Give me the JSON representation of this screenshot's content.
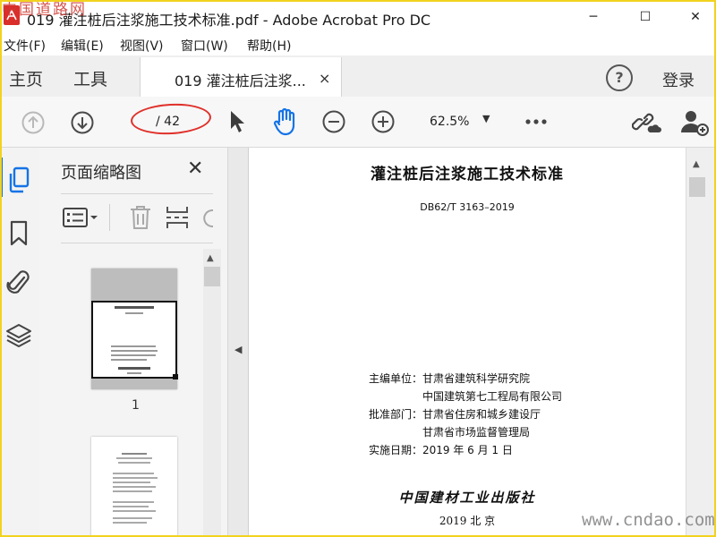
{
  "window": {
    "title": "019 灌注桩后注浆施工技术标准.pdf - Adobe Acrobat Pro DC",
    "controls": {
      "minimize": "─",
      "maximize": "☐",
      "close": "✕"
    }
  },
  "menu": [
    "文件(F)",
    "编辑(E)",
    "视图(V)",
    "窗口(W)",
    "帮助(H)"
  ],
  "tabs": {
    "home": "主页",
    "tools": "工具",
    "document": "019 灌注桩后注浆...",
    "document_close": "×",
    "help": "?",
    "login": "登录"
  },
  "toolbar": {
    "page_current": "",
    "page_total": "/ 42",
    "zoom": "62.5%",
    "icons": [
      "prev-page-icon",
      "next-page-icon",
      "select-cursor-icon",
      "hand-tool-icon",
      "zoom-out-icon",
      "zoom-in-icon",
      "more-icon",
      "share-link-icon",
      "add-user-icon"
    ]
  },
  "sidebar": {
    "rail_icons": [
      "page-thumbnails-icon",
      "bookmark-icon",
      "attachment-icon",
      "layers-icon"
    ],
    "panel_title": "页面缩略图",
    "panel_close": "✕",
    "thumbnails": [
      {
        "label": "1"
      },
      {
        "label": ""
      }
    ]
  },
  "document": {
    "title": "灌注桩后注浆施工技术标准",
    "standard_no": "DB62/T  3163–2019",
    "lines": [
      {
        "label": "主编单位：",
        "value": "甘肃省建筑科学研究院"
      },
      {
        "label": "",
        "value": "中国建筑第七工程局有限公司"
      },
      {
        "label": "批准部门：",
        "value": "甘肃省住房和城乡建设厅"
      },
      {
        "label": "",
        "value": "甘肃省市场监督管理局"
      },
      {
        "label": "实施日期：",
        "value": "2019 年 6 月 1 日"
      }
    ],
    "publisher": "中国建材工业出版社",
    "year_place": "2019 北 京"
  },
  "colors": {
    "accent": "#1473e6",
    "annotation": "#e0302a",
    "frame": "#f2d21e"
  },
  "watermarks": {
    "top_left": "中国道路网",
    "bottom_right": "www.cndao.com"
  }
}
